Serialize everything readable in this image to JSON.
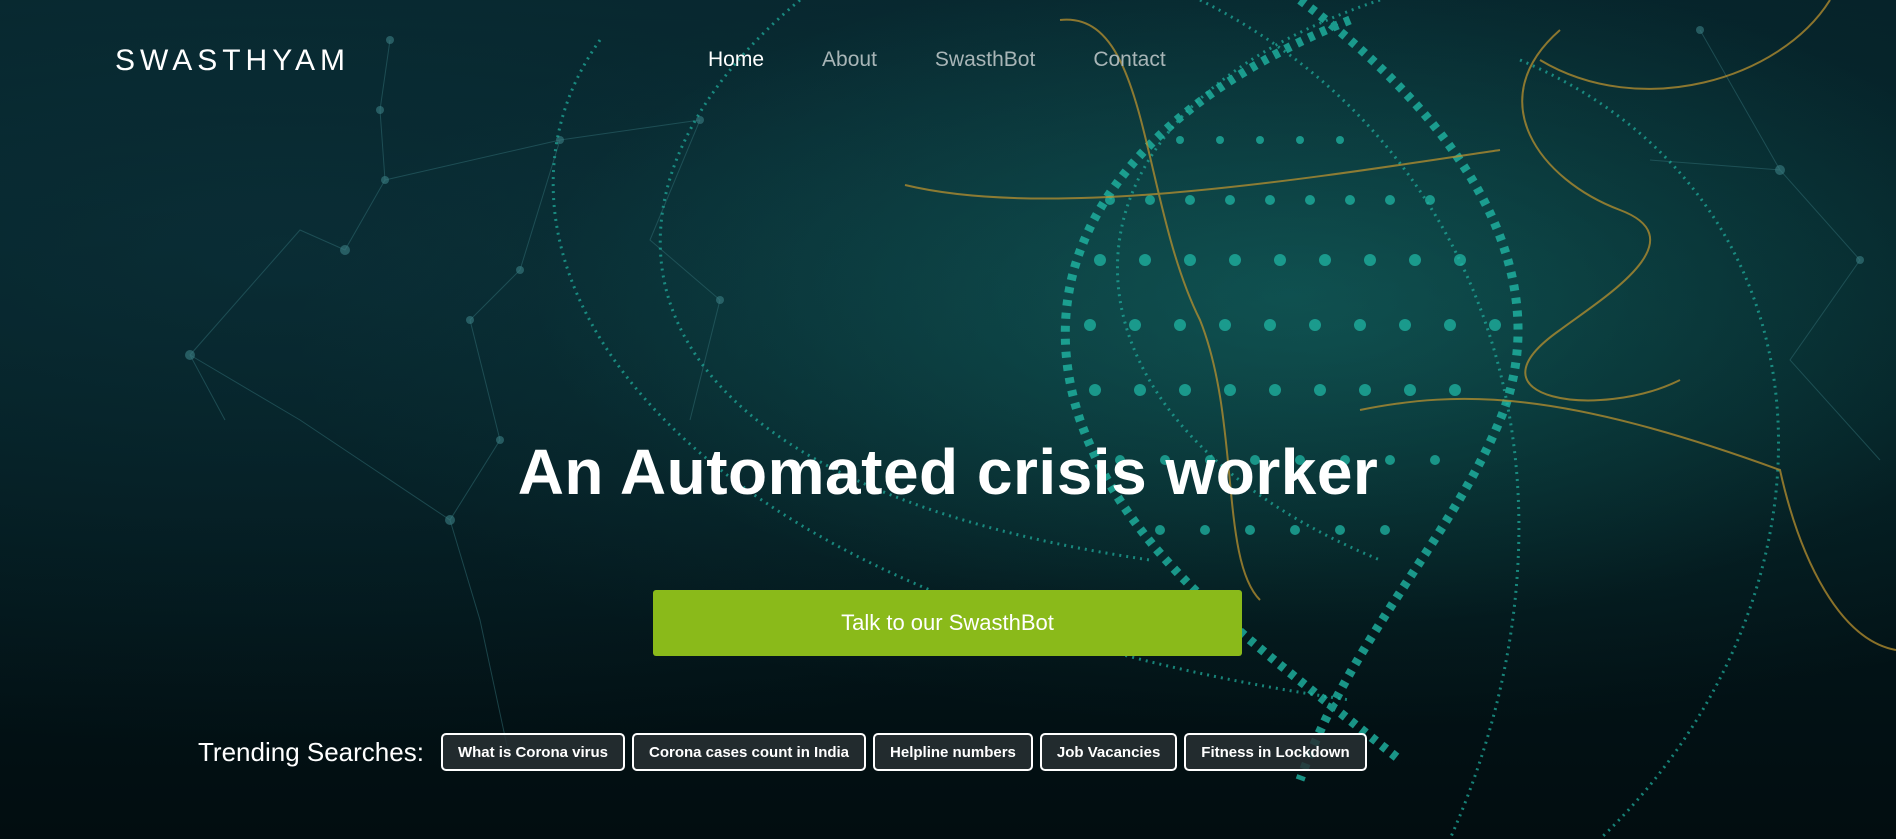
{
  "brand": {
    "logo_text": "SWASTHYAM"
  },
  "nav": {
    "items": [
      {
        "label": "Home",
        "active": true
      },
      {
        "label": "About",
        "active": false
      },
      {
        "label": "SwasthBot",
        "active": false
      },
      {
        "label": "Contact",
        "active": false
      }
    ]
  },
  "hero": {
    "title": "An Automated crisis worker",
    "cta_label": "Talk to our SwasthBot"
  },
  "trending": {
    "label": "Trending Searches:",
    "chips": [
      "What is Corona virus",
      "Corona cases count in India",
      "Helpline numbers",
      "Job Vacancies",
      "Fitness in Lockdown"
    ]
  },
  "colors": {
    "accent_green": "#8aba1a",
    "teal": "#1fa99a",
    "gold": "#b8902f",
    "background": "#03161a"
  }
}
